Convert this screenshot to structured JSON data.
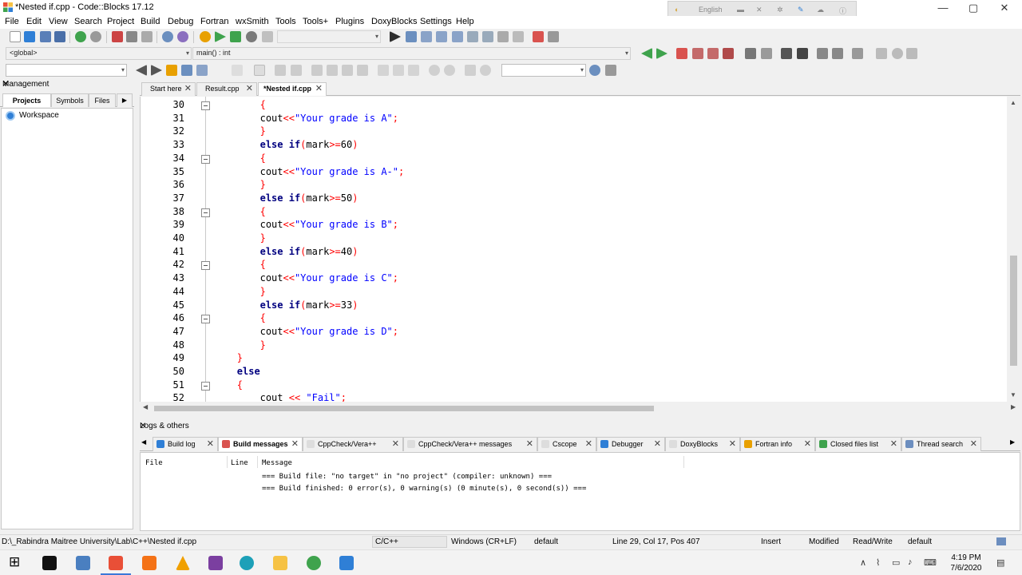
{
  "window": {
    "title": "*Nested if.cpp - Code::Blocks 17.12",
    "language_indicator": "English",
    "minimize_glyph": "—",
    "maximize_glyph": "▢",
    "close_glyph": "✕"
  },
  "menu": [
    "File",
    "Edit",
    "View",
    "Search",
    "Project",
    "Build",
    "Debug",
    "Fortran",
    "wxSmith",
    "Tools",
    "Tools+",
    "Plugins",
    "DoxyBlocks",
    "Settings",
    "Help"
  ],
  "scope_bar": {
    "scope": "<global>",
    "function": "main() : int"
  },
  "management": {
    "title": "Management",
    "close_glyph": "✕",
    "tabs": [
      "Projects",
      "Symbols",
      "Files"
    ],
    "arrow_glyph": "▶",
    "workspace": "Workspace"
  },
  "editor_tabs": [
    {
      "label": "Start here",
      "active": false
    },
    {
      "label": "Result.cpp",
      "active": false
    },
    {
      "label": "*Nested if.cpp",
      "active": true
    }
  ],
  "editor": {
    "line_numbers": [
      "30",
      "31",
      "32",
      "33",
      "34",
      "35",
      "36",
      "37",
      "38",
      "39",
      "40",
      "41",
      "42",
      "43",
      "44",
      "45",
      "46",
      "47",
      "48",
      "49",
      "50",
      "51",
      "52"
    ],
    "lines": [
      {
        "indent": 8,
        "parts": [
          {
            "t": "{",
            "c": "br"
          }
        ]
      },
      {
        "indent": 8,
        "parts": [
          {
            "t": "cout",
            "c": "plain"
          },
          {
            "t": "<<",
            "c": "op"
          },
          {
            "t": "\"Your grade is A\"",
            "c": "str"
          },
          {
            "t": ";",
            "c": "op"
          }
        ]
      },
      {
        "indent": 8,
        "parts": [
          {
            "t": "}",
            "c": "br"
          }
        ]
      },
      {
        "indent": 8,
        "parts": [
          {
            "t": "else if",
            "c": "kw"
          },
          {
            "t": "(",
            "c": "op"
          },
          {
            "t": "mark",
            "c": "plain"
          },
          {
            "t": ">=",
            "c": "op"
          },
          {
            "t": "60",
            "c": "plain"
          },
          {
            "t": ")",
            "c": "op"
          }
        ]
      },
      {
        "indent": 8,
        "parts": [
          {
            "t": "{",
            "c": "br"
          }
        ]
      },
      {
        "indent": 8,
        "parts": [
          {
            "t": "cout",
            "c": "plain"
          },
          {
            "t": "<<",
            "c": "op"
          },
          {
            "t": "\"Your grade is A-\"",
            "c": "str"
          },
          {
            "t": ";",
            "c": "op"
          }
        ]
      },
      {
        "indent": 8,
        "parts": [
          {
            "t": "}",
            "c": "br"
          }
        ]
      },
      {
        "indent": 8,
        "parts": [
          {
            "t": "else if",
            "c": "kw"
          },
          {
            "t": "(",
            "c": "op"
          },
          {
            "t": "mark",
            "c": "plain"
          },
          {
            "t": ">=",
            "c": "op"
          },
          {
            "t": "50",
            "c": "plain"
          },
          {
            "t": ")",
            "c": "op"
          }
        ]
      },
      {
        "indent": 8,
        "parts": [
          {
            "t": "{",
            "c": "br"
          }
        ]
      },
      {
        "indent": 8,
        "parts": [
          {
            "t": "cout",
            "c": "plain"
          },
          {
            "t": "<<",
            "c": "op"
          },
          {
            "t": "\"Your grade is B\"",
            "c": "str"
          },
          {
            "t": ";",
            "c": "op"
          }
        ]
      },
      {
        "indent": 8,
        "parts": [
          {
            "t": "}",
            "c": "br"
          }
        ]
      },
      {
        "indent": 8,
        "parts": [
          {
            "t": "else if",
            "c": "kw"
          },
          {
            "t": "(",
            "c": "op"
          },
          {
            "t": "mark",
            "c": "plain"
          },
          {
            "t": ">=",
            "c": "op"
          },
          {
            "t": "40",
            "c": "plain"
          },
          {
            "t": ")",
            "c": "op"
          }
        ]
      },
      {
        "indent": 8,
        "parts": [
          {
            "t": "{",
            "c": "br"
          }
        ]
      },
      {
        "indent": 8,
        "parts": [
          {
            "t": "cout",
            "c": "plain"
          },
          {
            "t": "<<",
            "c": "op"
          },
          {
            "t": "\"Your grade is C\"",
            "c": "str"
          },
          {
            "t": ";",
            "c": "op"
          }
        ]
      },
      {
        "indent": 8,
        "parts": [
          {
            "t": "}",
            "c": "br"
          }
        ]
      },
      {
        "indent": 8,
        "parts": [
          {
            "t": "else if",
            "c": "kw"
          },
          {
            "t": "(",
            "c": "op"
          },
          {
            "t": "mark",
            "c": "plain"
          },
          {
            "t": ">=",
            "c": "op"
          },
          {
            "t": "33",
            "c": "plain"
          },
          {
            "t": ")",
            "c": "op"
          }
        ]
      },
      {
        "indent": 8,
        "parts": [
          {
            "t": "{",
            "c": "br"
          }
        ]
      },
      {
        "indent": 8,
        "parts": [
          {
            "t": "cout",
            "c": "plain"
          },
          {
            "t": "<<",
            "c": "op"
          },
          {
            "t": "\"Your grade is D\"",
            "c": "str"
          },
          {
            "t": ";",
            "c": "op"
          }
        ]
      },
      {
        "indent": 8,
        "parts": [
          {
            "t": "}",
            "c": "br"
          }
        ]
      },
      {
        "indent": 4,
        "parts": [
          {
            "t": "}",
            "c": "br"
          }
        ]
      },
      {
        "indent": 4,
        "parts": [
          {
            "t": "else",
            "c": "kw"
          }
        ]
      },
      {
        "indent": 4,
        "parts": [
          {
            "t": "{",
            "c": "br"
          }
        ]
      },
      {
        "indent": 8,
        "parts": [
          {
            "t": "cout ",
            "c": "plain"
          },
          {
            "t": "<<",
            "c": "op"
          },
          {
            "t": " \"Fail\"",
            "c": "str"
          },
          {
            "t": ";",
            "c": "op"
          }
        ]
      }
    ],
    "fold_lines": [
      "30",
      "34",
      "38",
      "42",
      "46",
      "51"
    ]
  },
  "logs": {
    "title": "Logs & others",
    "close_glyph": "✕",
    "tabs": [
      {
        "label": "Build log",
        "active": false,
        "icon_color": "#2f7fd6"
      },
      {
        "label": "Build messages",
        "active": true,
        "icon_color": "#d9534f"
      },
      {
        "label": "CppCheck/Vera++",
        "active": false,
        "icon_color": ""
      },
      {
        "label": "CppCheck/Vera++ messages",
        "active": false,
        "icon_color": ""
      },
      {
        "label": "Cscope",
        "active": false,
        "icon_color": ""
      },
      {
        "label": "Debugger",
        "active": false,
        "icon_color": "#2f7fd6"
      },
      {
        "label": "DoxyBlocks",
        "active": false,
        "icon_color": ""
      },
      {
        "label": "Fortran info",
        "active": false,
        "icon_color": "#e8a000"
      },
      {
        "label": "Closed files list",
        "active": false,
        "icon_color": "#3fa34d"
      },
      {
        "label": "Thread search",
        "active": false,
        "icon_color": "#6c8ebf"
      }
    ],
    "columns": [
      "File",
      "Line",
      "Message"
    ],
    "messages": [
      "=== Build file: \"no target\" in \"no project\" (compiler: unknown) ===",
      "=== Build finished: 0 error(s), 0 warning(s) (0 minute(s), 0 second(s)) ==="
    ]
  },
  "status": {
    "path": "D:\\_Rabindra Maitree University\\Lab\\C++\\Nested if.cpp",
    "language": "C/C++",
    "eol": "Windows (CR+LF)",
    "encoding": "default",
    "position": "Line 29, Col 17, Pos 407",
    "mode": "Insert",
    "modified": "Modified",
    "access": "Read/Write",
    "extra": "default"
  },
  "taskbar": {
    "time": "4:19 PM",
    "date": "7/6/2020",
    "start_glyph": "⊞",
    "tray_up_glyph": "∧",
    "volume_glyph": "♪",
    "network_glyph": "⌇",
    "notification_glyph": "▤"
  },
  "colors": {
    "keyword": "#000080",
    "string": "#0000ff",
    "operator": "#ff0000"
  }
}
